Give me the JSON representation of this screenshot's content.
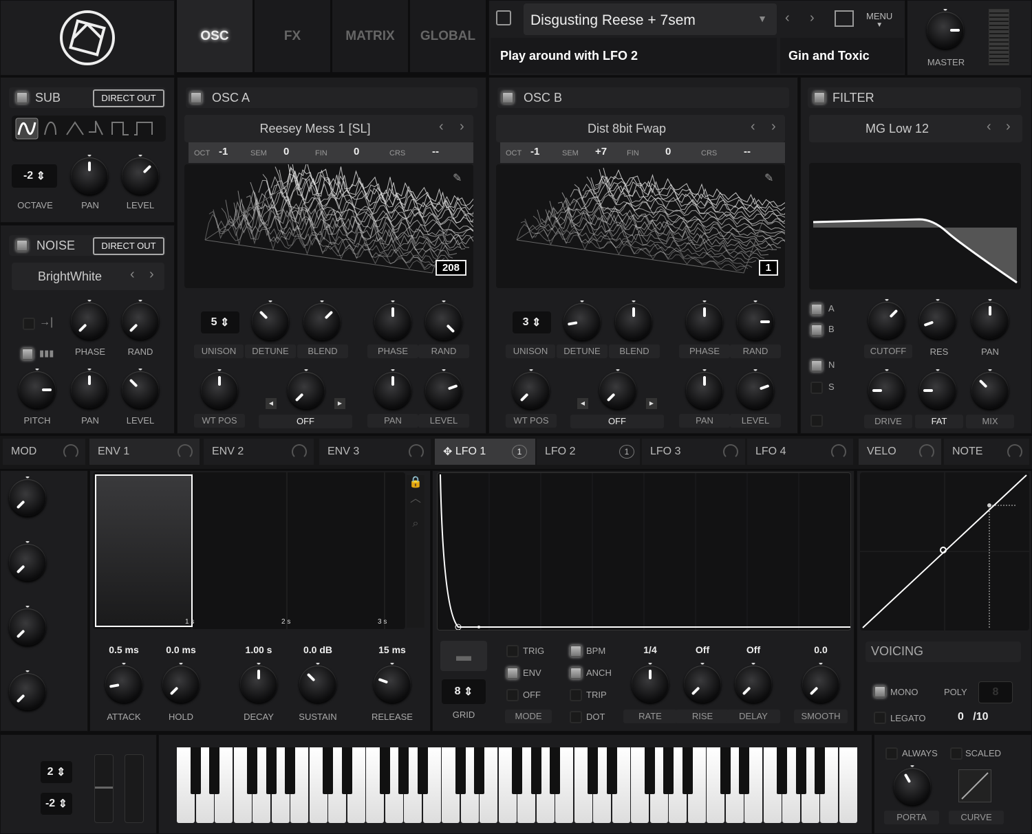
{
  "header": {
    "tabs": [
      "OSC",
      "FX",
      "MATRIX",
      "GLOBAL"
    ],
    "active_tab": "OSC",
    "preset_name": "Disgusting Reese + 7sem",
    "preset_comment": "Play around with LFO 2",
    "author": "Gin and Toxic",
    "menu_label": "MENU",
    "master_label": "MASTER"
  },
  "sub": {
    "title": "SUB",
    "direct_out": "DIRECT OUT",
    "octave": "-2",
    "labels": [
      "OCTAVE",
      "PAN",
      "LEVEL"
    ],
    "waveforms": [
      "sine",
      "round-saw",
      "triangle",
      "saw",
      "square",
      "pulse"
    ]
  },
  "noise": {
    "title": "NOISE",
    "direct_out": "DIRECT OUT",
    "sample": "BrightWhite",
    "labels": [
      "PHASE",
      "RAND",
      "PITCH",
      "PAN",
      "LEVEL"
    ]
  },
  "osc_a": {
    "title": "OSC A",
    "wavetable": "Reesey Mess 1 [SL]",
    "oct_label": "OCT",
    "oct": "-1",
    "sem_label": "SEM",
    "sem": "0",
    "fin_label": "FIN",
    "fin": "0",
    "crs_label": "CRS",
    "crs": "--",
    "frame": "208",
    "unison": "5",
    "labels": [
      "UNISON",
      "DETUNE",
      "BLEND",
      "PHASE",
      "RAND",
      "WT POS",
      "OFF",
      "PAN",
      "LEVEL"
    ]
  },
  "osc_b": {
    "title": "OSC B",
    "wavetable": "Dist 8bit Fwap",
    "oct_label": "OCT",
    "oct": "-1",
    "sem_label": "SEM",
    "sem": "+7",
    "fin_label": "FIN",
    "fin": "0",
    "crs_label": "CRS",
    "crs": "--",
    "frame": "1",
    "unison": "3",
    "labels": [
      "UNISON",
      "DETUNE",
      "BLEND",
      "PHASE",
      "RAND",
      "WT POS",
      "OFF",
      "PAN",
      "LEVEL"
    ]
  },
  "filter": {
    "title": "FILTER",
    "type": "MG Low 12",
    "routes": [
      "A",
      "B",
      "N",
      "S"
    ],
    "labels": [
      "CUTOFF",
      "RES",
      "PAN",
      "DRIVE",
      "FAT",
      "MIX"
    ]
  },
  "mod_tabs": [
    {
      "label": "MOD"
    },
    {
      "label": "ENV 1"
    },
    {
      "label": "ENV 2"
    },
    {
      "label": "ENV 3"
    },
    {
      "label": "LFO 1",
      "count": "1"
    },
    {
      "label": "LFO 2",
      "count": "1"
    },
    {
      "label": "LFO 3"
    },
    {
      "label": "LFO 4"
    },
    {
      "label": "VELO"
    },
    {
      "label": "NOTE"
    }
  ],
  "env": {
    "time_marks": [
      "1 s",
      "2 s",
      "3 s"
    ],
    "values": [
      "0.5 ms",
      "0.0 ms",
      "1.00 s",
      "0.0 dB",
      "15 ms"
    ],
    "labels": [
      "ATTACK",
      "HOLD",
      "DECAY",
      "SUSTAIN",
      "RELEASE"
    ]
  },
  "lfo": {
    "grid_value": "8",
    "grid_label": "GRID",
    "mode_options": [
      "TRIG",
      "ENV",
      "OFF"
    ],
    "mode_label": "MODE",
    "mode_selected": "ENV",
    "toggles": [
      "BPM",
      "ANCH",
      "TRIP",
      "DOT"
    ],
    "values": [
      "1/4",
      "Off",
      "Off",
      "0.0"
    ],
    "labels": [
      "RATE",
      "RISE",
      "DELAY",
      "SMOOTH"
    ]
  },
  "voicing": {
    "title": "VOICING",
    "mono": "MONO",
    "poly": "POLY",
    "poly_value": "8",
    "legato": "LEGATO",
    "voices": "0",
    "voices_max": "/10"
  },
  "bottom": {
    "bend_up": "2",
    "bend_down": "-2",
    "always": "ALWAYS",
    "scaled": "SCALED",
    "porta": "PORTA",
    "curve": "CURVE"
  }
}
